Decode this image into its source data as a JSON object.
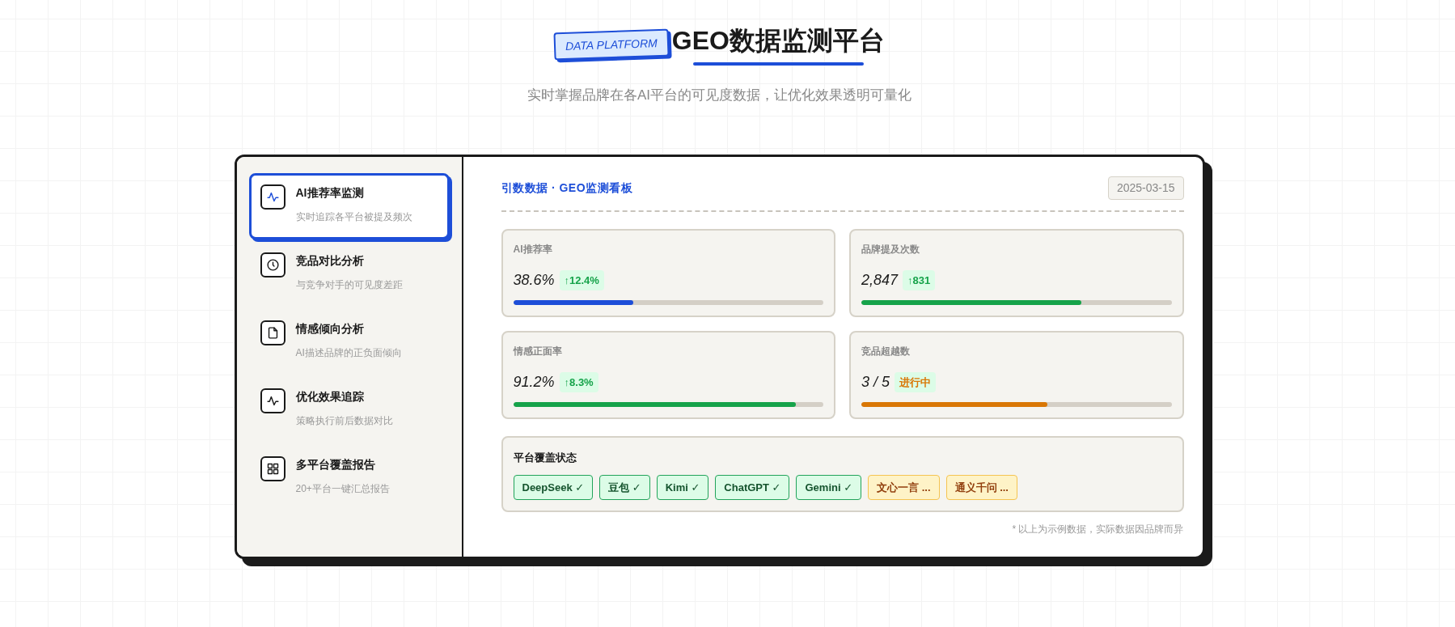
{
  "header": {
    "badge": "DATA PLATFORM",
    "title": "GEO数据监测平台",
    "subtitle": "实时掌握品牌在各AI平台的可见度数据，让优化效果透明可量化"
  },
  "sidebar": {
    "items": [
      {
        "kind": "pulse",
        "title": "AI推荐率监测",
        "description": "实时追踪各平台被提及频次",
        "selected": true
      },
      {
        "kind": "clock",
        "title": "竞品对比分析",
        "description": "与竞争对手的可见度差距",
        "selected": false
      },
      {
        "kind": "file",
        "title": "情感倾向分析",
        "description": "AI描述品牌的正负面倾向",
        "selected": false
      },
      {
        "kind": "pulse",
        "title": "优化效果追踪",
        "description": "策略执行前后数据对比",
        "selected": false
      },
      {
        "kind": "grid",
        "title": "多平台覆盖报告",
        "description": "20+平台一键汇总报告",
        "selected": false
      }
    ]
  },
  "dashboard": {
    "title": "引数数据 · GEO监测看板",
    "date": "2025-03-15",
    "metrics": [
      {
        "label": "AI推荐率",
        "value": "38.6%",
        "delta": {
          "text": "↑12.4%",
          "kind": "increase"
        },
        "level": 0.386,
        "color": "#1d4ed8"
      },
      {
        "label": "品牌提及次数",
        "value": "2,847",
        "delta": {
          "text": "↑831",
          "kind": "increase"
        },
        "level": 0.71,
        "color": "#16a34a"
      },
      {
        "label": "情感正面率",
        "value": "91.2%",
        "delta": {
          "text": "↑8.3%",
          "kind": "increase"
        },
        "level": 0.912,
        "color": "#16a34a"
      },
      {
        "label": "竞品超越数",
        "value": "3 / 5",
        "delta": {
          "text": "进行中",
          "kind": "progress"
        },
        "level": 0.6,
        "color": "#d97706"
      }
    ],
    "platform_coverage": {
      "title": "平台覆盖状态",
      "platforms": [
        {
          "name": "DeepSeek ✓",
          "kind": "covered"
        },
        {
          "name": "豆包 ✓",
          "kind": "covered"
        },
        {
          "name": "Kimi ✓",
          "kind": "covered"
        },
        {
          "name": "ChatGPT ✓",
          "kind": "covered"
        },
        {
          "name": "Gemini ✓",
          "kind": "covered"
        },
        {
          "name": "文心一言 ...",
          "kind": "pending"
        },
        {
          "name": "通义千问 ...",
          "kind": "pending"
        }
      ]
    },
    "footnote": "* 以上为示例数据，实际数据因品牌而异"
  }
}
